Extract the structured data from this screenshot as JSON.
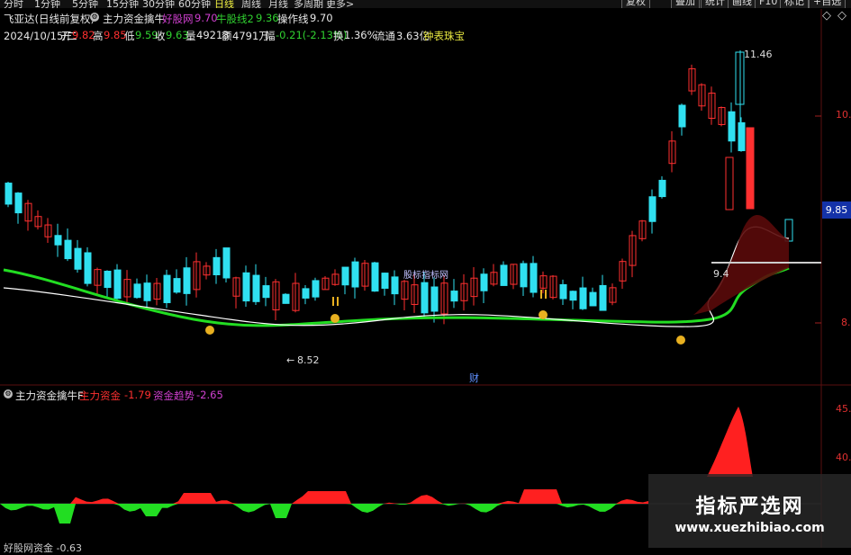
{
  "toolbar": {
    "periods": [
      "分时",
      "1分钟",
      "5分钟",
      "15分钟",
      "30分钟",
      "60分钟",
      "日线",
      "周线",
      "月线",
      "多周期",
      "更多>"
    ],
    "active_period": "日线",
    "buttons": [
      "复权",
      "叠加",
      "统计",
      "画线",
      "F10",
      "标记",
      "+自选"
    ]
  },
  "header": {
    "stock": "飞亚达(日线前复权)",
    "indicator": "主力资金擒牛",
    "items": [
      {
        "label": "好股网",
        "value": "9.70",
        "color": "#d040d0"
      },
      {
        "label": "牛股线2",
        "value": "9.36",
        "color": "#30d030"
      },
      {
        "label": "操作线",
        "value": "9.70",
        "color": "#e0e0e0"
      }
    ],
    "quote": {
      "date": "2024/10/15/二",
      "open_l": "开",
      "open": "9.82",
      "high_l": "高",
      "high": "9.85",
      "low_l": "低",
      "low": "9.59",
      "close_l": "收",
      "close": "9.63",
      "vol_l": "量",
      "vol": "49213",
      "amt_l": "额",
      "amt": "4791万",
      "chg_l": "幅",
      "chg": "-0.21(-2.13%)",
      "turn_l": "换",
      "turn": "1.36%",
      "flow_l": "流通",
      "flow": "3.63亿",
      "link": "钟表珠宝"
    }
  },
  "main_chart": {
    "watermark": "股标指标网",
    "max_label": "11.46",
    "min_label": "8.52",
    "op_label": "9.4",
    "price_tag": "9.85",
    "y_labels": [
      "10.",
      "8."
    ],
    "cai_label": "财",
    "colors": {
      "up": "#ff3030",
      "down": "#30e0f0",
      "ma_green": "#22dd22",
      "ma_white": "#ffffff"
    }
  },
  "sub_chart": {
    "title": "主力资金擒牛F",
    "items": [
      {
        "label": "主力资金",
        "value": "-1.79",
        "color": "#ff3030"
      },
      {
        "label": "资金趋势",
        "value": "-2.65",
        "color": "#d040d0"
      }
    ],
    "y_labels": [
      "45.",
      "40."
    ],
    "bottom_text": "好股网资金 -0.63"
  },
  "watermark": {
    "title": "指标严选网",
    "url": "www.xuezhibiao.com"
  }
}
